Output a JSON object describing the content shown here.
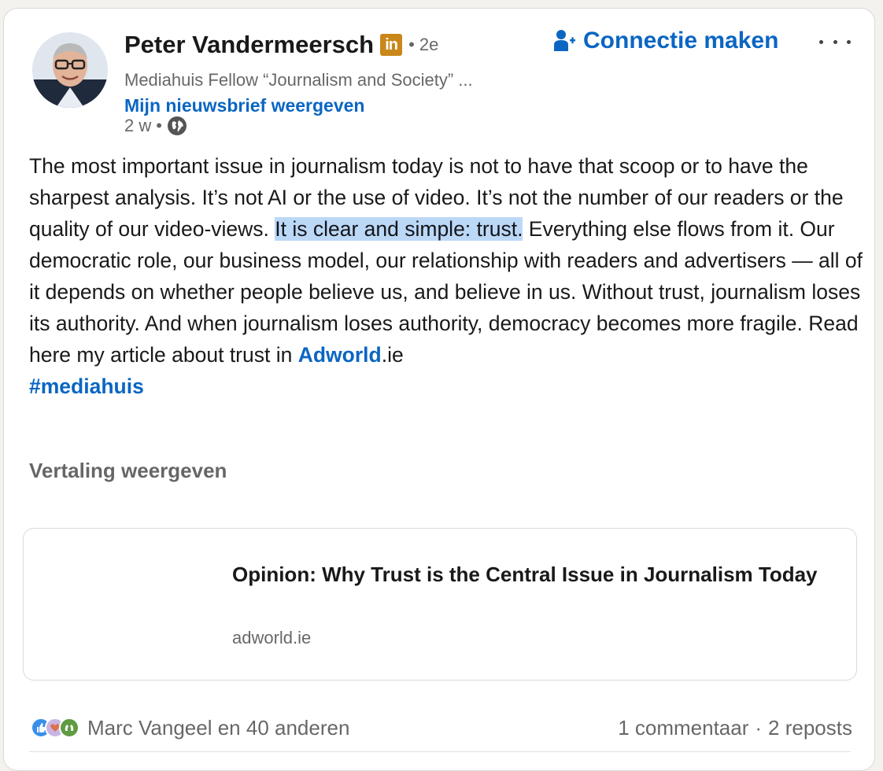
{
  "author": {
    "name": "Peter Vandermeersch",
    "badge": "in",
    "degree": "• 2e",
    "headline": "Mediahuis Fellow “Journalism and Society” ...",
    "newsletter_link": "Mijn nieuwsbrief weergeven",
    "time": "2 w",
    "meta_separator": "•"
  },
  "actions": {
    "connect_label": "Connectie maken"
  },
  "post": {
    "text_before": "The most important issue in journalism today is not to have that scoop or to have the sharpest analysis. It’s not AI or the use of video. It’s not the number of our readers or the quality of our video-views. ",
    "text_highlight": "It is clear and simple: trust.",
    "text_after": " Everything else flows from it. Our democratic role, our business model, our relationship with readers and advertisers — all of it depends on whether people believe us, and believe in us. Without trust, journalism loses its authority. And when journalism loses authority, democracy becomes more fragile. Read here my article about trust in ",
    "link_text": "Adworld",
    "link_suffix": ".ie",
    "hashtag": "#mediahuis",
    "translation_label": "Vertaling weergeven"
  },
  "article": {
    "title": "Opinion: Why Trust is the Central Issue in Journalism Today",
    "source": "adworld.ie"
  },
  "social": {
    "reactions_label": "Marc Vangeel en 40 anderen",
    "comments": "1 commentaar",
    "separator": "·",
    "reposts": "2 reposts"
  },
  "colors": {
    "link_blue": "#0a66c2",
    "highlight": "#bcd8f7",
    "premium_badge": "#c9871a"
  },
  "icons": {
    "connect": "add-person-icon",
    "visibility": "globe-icon",
    "more": "ellipsis-icon",
    "reactions": [
      "like-icon",
      "love-icon",
      "support-icon"
    ]
  }
}
